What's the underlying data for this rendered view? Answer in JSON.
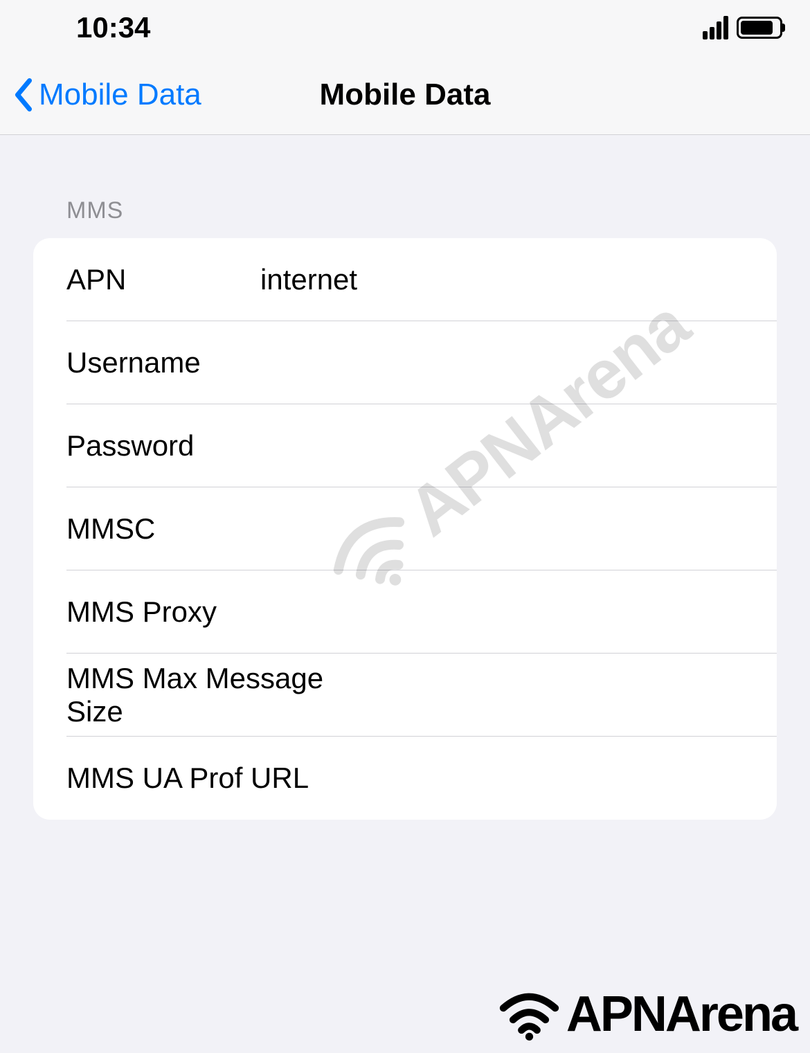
{
  "statusBar": {
    "time": "10:34"
  },
  "navBar": {
    "backLabel": "Mobile Data",
    "title": "Mobile Data"
  },
  "section": {
    "header": "MMS",
    "rows": {
      "apn": {
        "label": "APN",
        "value": "internet"
      },
      "username": {
        "label": "Username",
        "value": ""
      },
      "password": {
        "label": "Password",
        "value": ""
      },
      "mmsc": {
        "label": "MMSC",
        "value": ""
      },
      "mmsProxy": {
        "label": "MMS Proxy",
        "value": ""
      },
      "mmsMaxSize": {
        "label": "MMS Max Message Size",
        "value": ""
      },
      "mmsUaProf": {
        "label": "MMS UA Prof URL",
        "value": ""
      }
    }
  },
  "watermark": "APNArena",
  "footerLogo": "APNArena"
}
